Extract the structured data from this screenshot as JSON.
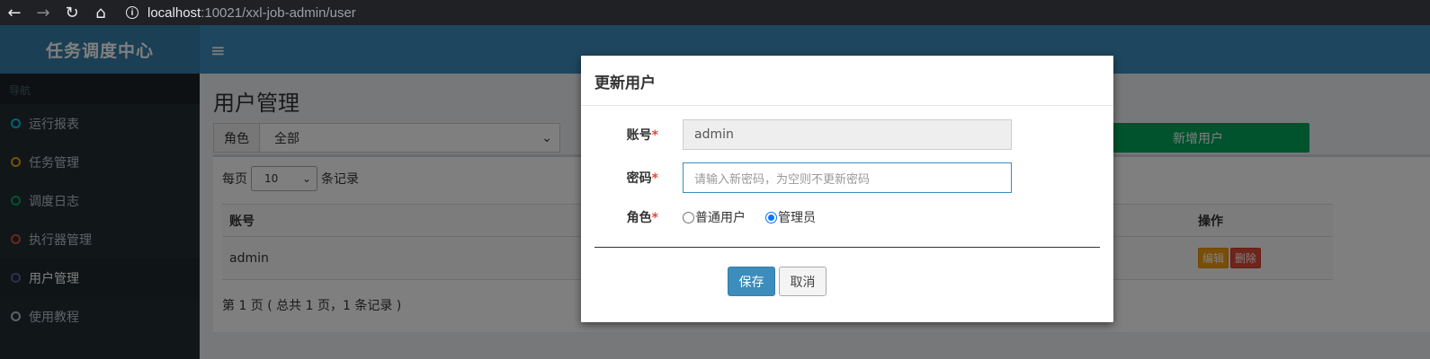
{
  "browser": {
    "url_host": "localhost",
    "url_path": ":10021/xxl-job-admin/user"
  },
  "app": {
    "logo_text": "任务调度中心",
    "menu_icon": "hamburger-icon"
  },
  "sidebar": {
    "header": "导航",
    "items": [
      {
        "label": "运行报表",
        "color": "#00c0ef"
      },
      {
        "label": "任务管理",
        "color": "#f39c12"
      },
      {
        "label": "调度日志",
        "color": "#00a65a"
      },
      {
        "label": "执行器管理",
        "color": "#dd4b39"
      },
      {
        "label": "用户管理",
        "color": "#605ca8"
      },
      {
        "label": "使用教程",
        "color": "#b8c7ce"
      }
    ]
  },
  "main": {
    "title": "用户管理",
    "filter_label": "角色",
    "filter_value": "全部",
    "add_button": "新增用户",
    "per_page_prefix": "每页",
    "per_page_value": "10",
    "per_page_suffix": "条记录",
    "columns": {
      "account": "账号",
      "ops": "操作"
    },
    "rows": [
      {
        "account": "admin",
        "edit": "编辑",
        "delete": "删除"
      }
    ],
    "pager_info": "第 1 页 ( 总共 1 页，1 条记录 )"
  },
  "modal": {
    "title": "更新用户",
    "account_label": "账号",
    "account_value": "admin",
    "password_label": "密码",
    "password_placeholder": "请输入新密码，为空则不更新密码",
    "role_label": "角色",
    "role_options": [
      "普通用户",
      "管理员"
    ],
    "role_selected": "管理员",
    "required_mark": "*",
    "save": "保存",
    "cancel": "取消"
  }
}
